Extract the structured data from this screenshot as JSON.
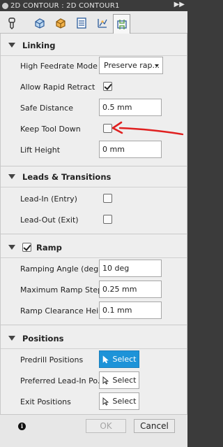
{
  "window": {
    "title": "2D CONTOUR : 2D CONTOUR1"
  },
  "tabs": [
    {
      "name": "tool-icon"
    },
    {
      "name": "geometry-icon"
    },
    {
      "name": "heights-icon"
    },
    {
      "name": "passes-icon"
    },
    {
      "name": "linking-icon"
    },
    {
      "name": "leads-icon"
    }
  ],
  "sections": {
    "linking": {
      "label": "Linking",
      "high_feedrate_mode": {
        "label": "High Feedrate Mode",
        "value": "Preserve rap..."
      },
      "allow_rapid_retract": {
        "label": "Allow Rapid Retract",
        "checked": true
      },
      "safe_distance": {
        "label": "Safe Distance",
        "value": "0.5 mm"
      },
      "keep_tool_down": {
        "label": "Keep Tool Down",
        "checked": false
      },
      "lift_height": {
        "label": "Lift Height",
        "value": "0 mm"
      }
    },
    "leads": {
      "label": "Leads & Transitions",
      "lead_in": {
        "label": "Lead-In (Entry)",
        "checked": false
      },
      "lead_out": {
        "label": "Lead-Out (Exit)",
        "checked": false
      }
    },
    "ramp": {
      "label": "Ramp",
      "enabled": true,
      "ramping_angle": {
        "label": "Ramping Angle (deg)",
        "value": "10 deg"
      },
      "max_ramp_step": {
        "label": "Maximum Ramp Step...",
        "value": "0.25 mm"
      },
      "ramp_clearance": {
        "label": "Ramp Clearance Hei...",
        "value": "0.1 mm"
      }
    },
    "positions": {
      "label": "Positions",
      "predrill": {
        "label": "Predrill Positions",
        "button": "Select"
      },
      "preferred_lead_in": {
        "label": "Preferred Lead-In Po...",
        "button": "Select"
      },
      "exit": {
        "label": "Exit Positions",
        "button": "Select"
      }
    }
  },
  "footer": {
    "info": "i",
    "ok": "OK",
    "cancel": "Cancel"
  },
  "colors": {
    "select_active": "#1d93d8",
    "annotation_arrow": "#e02020"
  }
}
